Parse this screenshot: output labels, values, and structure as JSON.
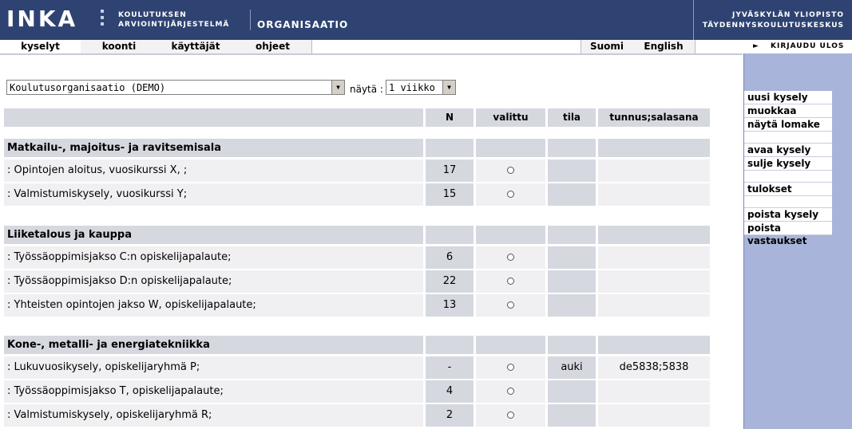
{
  "header": {
    "logo": "INKA",
    "system_line1": "KOULUTUKSEN",
    "system_line2": "ARVIOINTIJÄRJESTELMÄ",
    "section": "ORGANISAATIO",
    "university_line1": "JYVÄSKYLÄN YLIOPISTO",
    "university_line2": "TÄYDENNYSKOULUTUSKESKUS"
  },
  "nav": {
    "tabs": [
      {
        "label": "kyselyt",
        "active": true
      },
      {
        "label": "koonti",
        "active": false
      },
      {
        "label": "käyttäjät",
        "active": false
      },
      {
        "label": "ohjeet",
        "active": false
      }
    ],
    "lang_fi": "Suomi",
    "lang_en": "English",
    "logout": "KIRJAUDU ULOS"
  },
  "controls": {
    "organization": "Koulutusorganisaatio (DEMO)",
    "show_label": "näytä :",
    "period": "1 viikko"
  },
  "table": {
    "headers": {
      "n": "N",
      "selected": "valittu",
      "state": "tila",
      "credentials": "tunnus;salasana"
    },
    "groups": [
      {
        "title": "Matkailu-, majoitus- ja ravitsemisala",
        "rows": [
          {
            "label": ": Opintojen aloitus, vuosikurssi X, ;",
            "n": "17",
            "state": "",
            "credentials": ""
          },
          {
            "label": ": Valmistumiskysely, vuosikurssi Y;",
            "n": "15",
            "state": "",
            "credentials": ""
          }
        ]
      },
      {
        "title": "Liiketalous ja kauppa",
        "rows": [
          {
            "label": ": Työssäoppimisjakso C:n opiskelijapalaute;",
            "n": "6",
            "state": "",
            "credentials": ""
          },
          {
            "label": ": Työssäoppimisjakso D:n opiskelijapalaute;",
            "n": "22",
            "state": "",
            "credentials": ""
          },
          {
            "label": ": Yhteisten opintojen jakso W, opiskelijapalaute;",
            "n": "13",
            "state": "",
            "credentials": ""
          }
        ]
      },
      {
        "title": "Kone-, metalli- ja energiatekniikka",
        "rows": [
          {
            "label": ": Lukuvuosikysely, opiskelijaryhmä P;",
            "n": "-",
            "state": "auki",
            "credentials": "de5838;5838"
          },
          {
            "label": ": Työssäoppimisjakso T, opiskelijapalaute;",
            "n": "4",
            "state": "",
            "credentials": ""
          },
          {
            "label": ": Valmistumiskysely, opiskelijaryhmä R;",
            "n": "2",
            "state": "",
            "credentials": ""
          }
        ]
      }
    ]
  },
  "sidebar": {
    "new_survey": "uusi kysely",
    "edit": "muokkaa",
    "show_form": "näytä lomake",
    "open_survey": "avaa kysely",
    "close_survey": "sulje kysely",
    "results": "tulokset",
    "delete_survey": "poista kysely",
    "delete_answers": "poista vastaukset"
  },
  "colors": {
    "header_bg": "#2e4372",
    "sidebar_bg": "#a9b4da",
    "cell_bg": "#d6d8e0"
  }
}
